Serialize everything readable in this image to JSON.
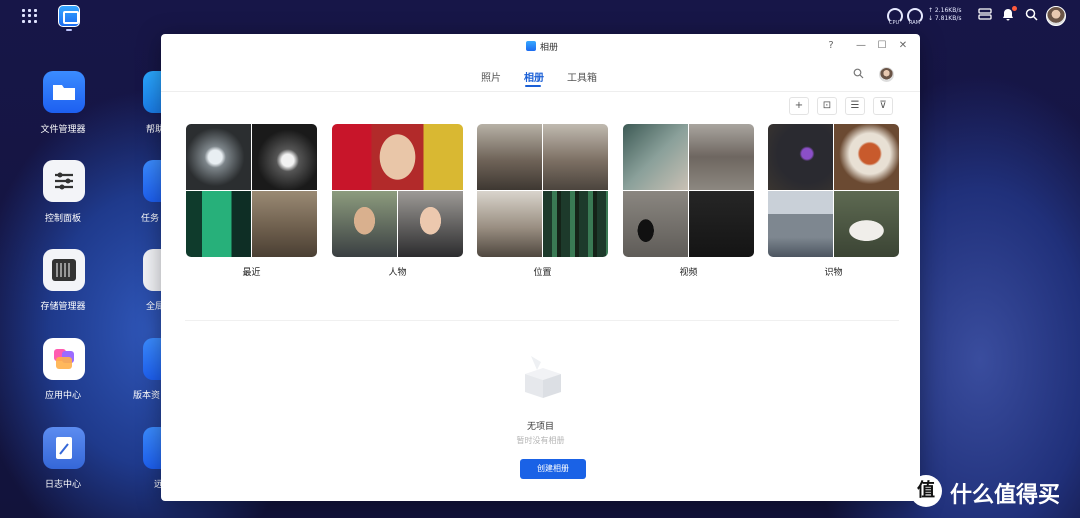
{
  "topbar": {
    "cpu_label": "CPU",
    "ram_label": "RAM",
    "upload_speed": "↑ 2.16KB/s",
    "download_speed": "↓ 7.81KB/s"
  },
  "desktop": {
    "apps": [
      {
        "label": "文件管理器"
      },
      {
        "label": "控制面板"
      },
      {
        "label": "存储管理器"
      },
      {
        "label": "应用中心"
      },
      {
        "label": "日志中心"
      }
    ],
    "apps_col2": [
      {
        "label": "帮助"
      },
      {
        "label": "任务"
      },
      {
        "label": "全局"
      },
      {
        "label": "版本资"
      },
      {
        "label": "远"
      }
    ]
  },
  "window": {
    "title": "相册",
    "controls": {
      "help": "?",
      "minimize": "—",
      "maximize": "☐",
      "close": "✕"
    },
    "tabs": [
      {
        "label": "照片",
        "active": false
      },
      {
        "label": "相册",
        "active": true
      },
      {
        "label": "工具箱",
        "active": false
      }
    ],
    "toolbar": {
      "add": "+",
      "face": "⊡",
      "sort": "☰",
      "filter": "⊽"
    },
    "categories": [
      {
        "label": "最近"
      },
      {
        "label": "人物"
      },
      {
        "label": "位置"
      },
      {
        "label": "视频"
      },
      {
        "label": "识物"
      }
    ],
    "empty_state": {
      "title": "无项目",
      "subtitle": "暂时没有相册",
      "button": "创建相册"
    }
  },
  "watermark": {
    "logo": "值",
    "text": "什么值得买"
  },
  "colors": {
    "accent": "#1a62e6",
    "active_tab": "#1a5fd6",
    "notification": "#ff5a3c"
  }
}
